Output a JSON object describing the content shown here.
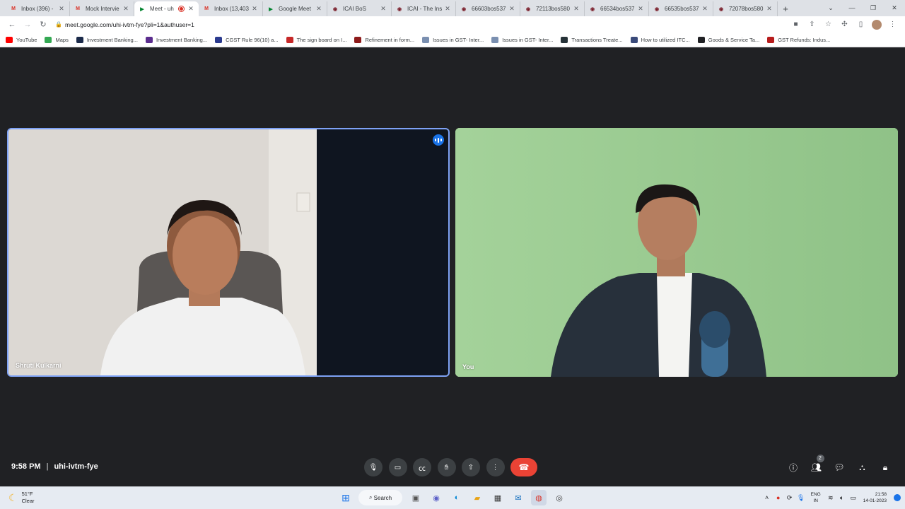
{
  "browser": {
    "tabs": [
      {
        "title": "Inbox (396) -",
        "icon": "gmail-icon",
        "active": false
      },
      {
        "title": "Mock Intervie",
        "icon": "gmail-icon",
        "active": false
      },
      {
        "title": "Meet - uh",
        "icon": "meet-icon",
        "active": true,
        "recording": true
      },
      {
        "title": "Inbox (13,403",
        "icon": "gmail-icon",
        "active": false
      },
      {
        "title": "Google Meet",
        "icon": "meet-icon",
        "active": false
      },
      {
        "title": "ICAI BoS",
        "icon": "icai-icon",
        "active": false
      },
      {
        "title": "ICAI - The Ins",
        "icon": "icai-icon",
        "active": false
      },
      {
        "title": "66603bos537",
        "icon": "icai-icon",
        "active": false
      },
      {
        "title": "72113bos580",
        "icon": "icai-icon",
        "active": false
      },
      {
        "title": "66534bos537",
        "icon": "icai-icon",
        "active": false
      },
      {
        "title": "66535bos537",
        "icon": "icai-icon",
        "active": false
      },
      {
        "title": "72078bos580",
        "icon": "icai-icon",
        "active": false
      }
    ],
    "url": "meet.google.com/uhi-ivtm-fye?pli=1&authuser=1",
    "bookmarks": [
      {
        "label": "YouTube",
        "color": "#ff0000"
      },
      {
        "label": "Maps",
        "color": "#34a853"
      },
      {
        "label": "Investment Banking...",
        "color": "#1b2a4a"
      },
      {
        "label": "Investment Banking...",
        "color": "#5b2d8e"
      },
      {
        "label": "CGST Rule 96(10) a...",
        "color": "#2b3a8f"
      },
      {
        "label": "The sign board on I...",
        "color": "#c62828"
      },
      {
        "label": "Refinement in form...",
        "color": "#8e1b1b"
      },
      {
        "label": "Issues in GST- Inter...",
        "color": "#7a8fb0"
      },
      {
        "label": "Issues in GST- Inter...",
        "color": "#7a8fb0"
      },
      {
        "label": "Transactions Treate...",
        "color": "#263238"
      },
      {
        "label": "How to utilized ITC...",
        "color": "#3a4a7a"
      },
      {
        "label": "Goods & Service Ta...",
        "color": "#202124"
      },
      {
        "label": "GST Refunds: Indus...",
        "color": "#b71c1c"
      }
    ]
  },
  "meet": {
    "participants": [
      {
        "name": "Shruti Kulkarni",
        "speaking": true
      },
      {
        "name": "You",
        "speaking": false
      }
    ],
    "time": "9:58 PM",
    "meeting_code": "uhi-ivtm-fye",
    "people_count": "2",
    "colors": {
      "background": "#202124",
      "end_call": "#ea4335",
      "active_border": "#7ea2f5"
    }
  },
  "taskbar": {
    "weather_temp": "51°F",
    "weather_desc": "Clear",
    "search_label": "Search",
    "lang_line1": "ENG",
    "lang_line2": "IN",
    "clock_time": "21:58",
    "clock_date": "14-01-2023"
  }
}
